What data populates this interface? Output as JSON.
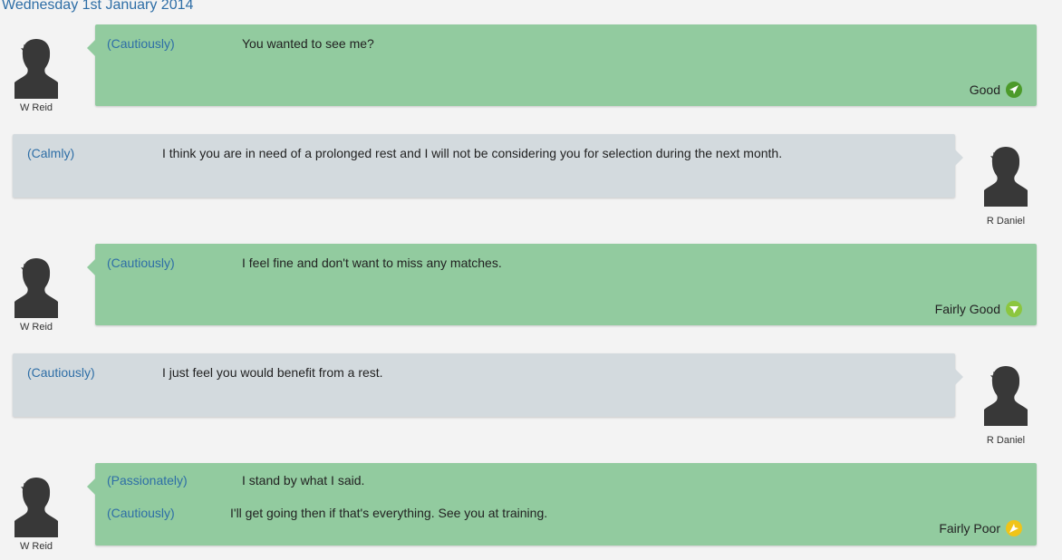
{
  "date": "Wednesday 1st January 2014",
  "messages": [
    {
      "speaker": "W Reid",
      "side": "left",
      "lines": [
        {
          "tone": "(Cautiously)",
          "text": "You wanted to see me?"
        }
      ],
      "reaction": {
        "label": "Good",
        "color": "#4c9a2a"
      }
    },
    {
      "speaker": "R Daniel",
      "side": "right",
      "lines": [
        {
          "tone": "(Calmly)",
          "text": "I think you are in need of a prolonged rest and I will not be considering you for selection during the next month."
        }
      ]
    },
    {
      "speaker": "W Reid",
      "side": "left",
      "lines": [
        {
          "tone": "(Cautiously)",
          "text": "I feel fine and don't want to miss any matches."
        }
      ],
      "reaction": {
        "label": "Fairly Good",
        "color": "#8cc63f"
      }
    },
    {
      "speaker": "R Daniel",
      "side": "right",
      "lines": [
        {
          "tone": "(Cautiously)",
          "text": "I just feel you would benefit from a rest."
        }
      ]
    },
    {
      "speaker": "W Reid",
      "side": "left",
      "lines": [
        {
          "tone": "(Passionately)",
          "text": "I stand by what I said."
        },
        {
          "tone": "(Cautiously)",
          "text": "I'll get going then if that's everything. See you at training."
        }
      ],
      "reaction": {
        "label": "Fairly Poor",
        "color": "#f0c419"
      }
    }
  ],
  "icons": {
    "avatar": "person-silhouette-icon",
    "reaction_good": "arrow-up-right-icon",
    "reaction_fairly_good": "arrow-up-right-icon",
    "reaction_fairly_poor": "arrow-down-left-icon"
  }
}
